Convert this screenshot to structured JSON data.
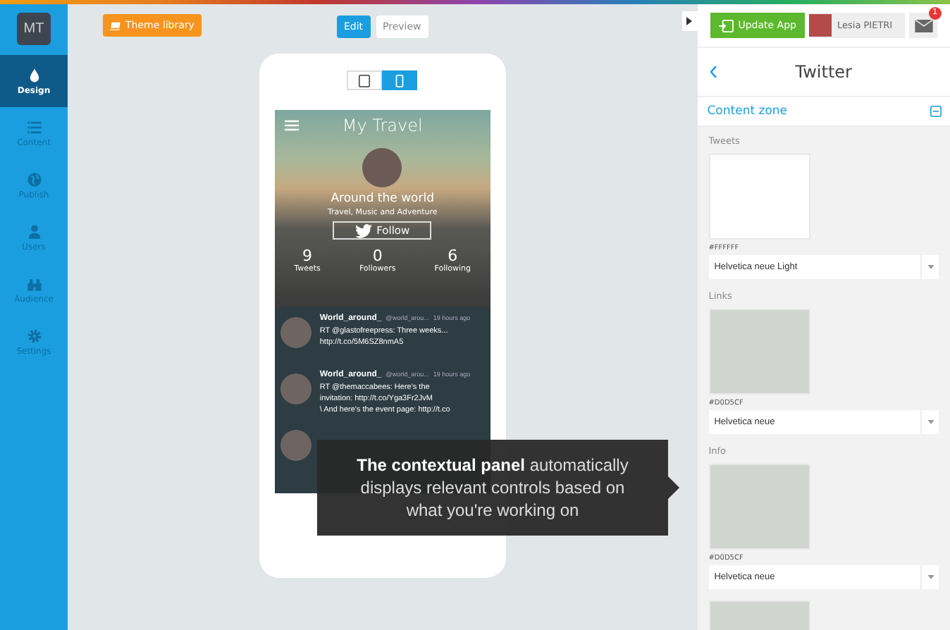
{
  "logo": "MT",
  "sidebar": {
    "items": [
      {
        "label": "Design",
        "selected": true
      },
      {
        "label": "Content",
        "selected": false
      },
      {
        "label": "Publish",
        "selected": false
      },
      {
        "label": "Users",
        "selected": false
      },
      {
        "label": "Audience",
        "selected": false
      },
      {
        "label": "Settings",
        "selected": false
      }
    ]
  },
  "toolbar": {
    "theme_button": "Theme library",
    "modes": [
      {
        "label": "Edit",
        "selected": true
      },
      {
        "label": "Preview",
        "selected": false
      }
    ]
  },
  "devices": [
    {
      "kind": "tablet",
      "selected": false
    },
    {
      "kind": "phone",
      "selected": true
    }
  ],
  "app": {
    "title": "My Travel",
    "profile_name": "Around the world",
    "profile_bio": "Travel, Music and Adventure",
    "follow": "Follow",
    "stats": [
      {
        "value": "9",
        "label": "Tweets"
      },
      {
        "value": "0",
        "label": "Followers"
      },
      {
        "value": "6",
        "label": "Following"
      }
    ],
    "tweets": [
      {
        "kind": "full",
        "user": "World_around_",
        "handle": "@world_arou...",
        "time": "19 hours ago",
        "lines": [
          "RT @glastofreepress: Three weeks...",
          "http://t.co/5M6SZ8nmA5"
        ]
      },
      {
        "kind": "full",
        "user": "World_around_",
        "handle": "@world_arou...",
        "time": "19 hours ago",
        "lines": [
          "RT @themaccabees: Here's the",
          "invitation: http://t.co/Yga3Fr2JvM",
          "\\ And here's the event page: http://t.co"
        ]
      },
      {
        "kind": "covered"
      }
    ]
  },
  "tooltip": "**The contextual panel** automatically displays relevant controls based on what you're working on",
  "header": {
    "update_button": "Update App",
    "user_name": "Lesia PIETRI",
    "mail_badge": "1"
  },
  "panel": {
    "title": "Twitter",
    "section": "Content zone",
    "expanded": true,
    "fields": [
      {
        "label": "Tweets",
        "color": "#ffffff",
        "hex": "#FFFFFF",
        "font": "Helvetica neue Light"
      },
      {
        "label": "Links",
        "color": "#d0d5cf",
        "hex": "#D0D5CF",
        "font": "Helvetica neue"
      },
      {
        "label": "Info",
        "color": "#d0d5cf",
        "hex": "#D0D5CF",
        "font": "Helvetica neue"
      },
      {
        "color": "#d0d5cf"
      }
    ]
  }
}
